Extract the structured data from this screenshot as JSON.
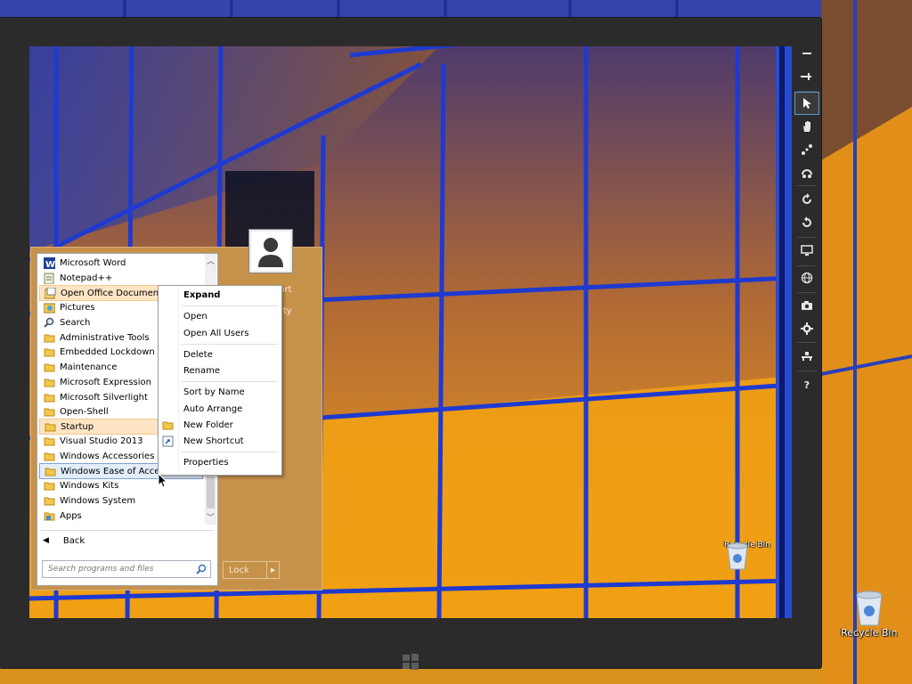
{
  "start_menu": {
    "programs": [
      {
        "label": "Microsoft Word",
        "icon": "word-icon"
      },
      {
        "label": "Notepad++",
        "icon": "notepad-icon"
      },
      {
        "label": "Open Office Document",
        "icon": "open-office-icon"
      },
      {
        "label": "Pictures",
        "icon": "pictures-icon"
      },
      {
        "label": "Search",
        "icon": "search-icon"
      },
      {
        "label": "Administrative Tools",
        "icon": "folder-icon"
      },
      {
        "label": "Embedded Lockdown Ma",
        "icon": "folder-icon"
      },
      {
        "label": "Maintenance",
        "icon": "folder-icon"
      },
      {
        "label": "Microsoft Expression",
        "icon": "folder-icon"
      },
      {
        "label": "Microsoft Silverlight",
        "icon": "folder-icon"
      },
      {
        "label": "Open-Shell",
        "icon": "folder-icon"
      },
      {
        "label": "Startup",
        "icon": "folder-icon"
      },
      {
        "label": "Visual Studio 2013",
        "icon": "folder-icon"
      },
      {
        "label": "Windows Accessories",
        "icon": "folder-icon"
      },
      {
        "label": "Windows Ease of Access",
        "icon": "folder-icon"
      },
      {
        "label": "Windows Kits",
        "icon": "folder-icon"
      },
      {
        "label": "Windows System",
        "icon": "folder-icon"
      },
      {
        "label": "Apps",
        "icon": "apps-icon"
      }
    ],
    "back_label": "Back",
    "search_placeholder": "Search programs and files",
    "right_items": [
      "port",
      "rity"
    ],
    "lock_label": "Lock"
  },
  "context_menu": {
    "items": [
      "Expand",
      "Open",
      "Open All Users",
      "Delete",
      "Rename",
      "Sort by Name",
      "Auto Arrange",
      "New Folder",
      "New Shortcut",
      "Properties"
    ]
  },
  "desktop": {
    "recycle_bin_label": "Recycle Bin"
  },
  "colors": {
    "menu_bg": "#c6924a",
    "highlight_orange": "#fde5c4",
    "highlight_blue": "#e3eefb"
  }
}
